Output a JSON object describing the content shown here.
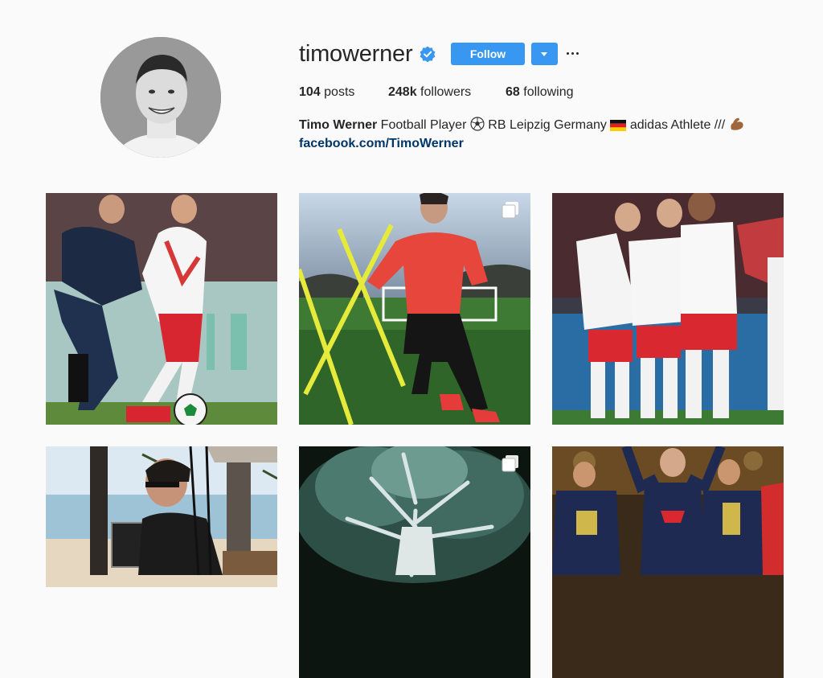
{
  "profile": {
    "username": "timowerner",
    "follow_label": "Follow",
    "stats": {
      "posts_count": "104",
      "posts_label": "posts",
      "followers_count": "248k",
      "followers_label": "followers",
      "following_count": "68",
      "following_label": "following"
    },
    "bio": {
      "name": "Timo Werner",
      "text1": "Football Player",
      "text2": "RB Leipzig Germany",
      "text3": "adidas Athlete ///",
      "link": "facebook.com/TimoWerner"
    }
  },
  "icons": {
    "verified": "verified-badge-icon",
    "dropdown": "chevron-down-icon",
    "more": "more-options-icon",
    "multi": "multiple-photos-icon"
  },
  "colors": {
    "accent": "#3897f0",
    "link": "#003569",
    "text": "#262626",
    "background": "#fafafa"
  },
  "posts": [
    {
      "desc": "tackle-with-opponent",
      "multiple": false
    },
    {
      "desc": "training-red-shirt",
      "multiple": true
    },
    {
      "desc": "team-celebration",
      "multiple": false
    },
    {
      "desc": "beach-selfie",
      "multiple": false
    },
    {
      "desc": "illuminated-tree",
      "multiple": true
    },
    {
      "desc": "germany-team-lineup",
      "multiple": false
    }
  ]
}
